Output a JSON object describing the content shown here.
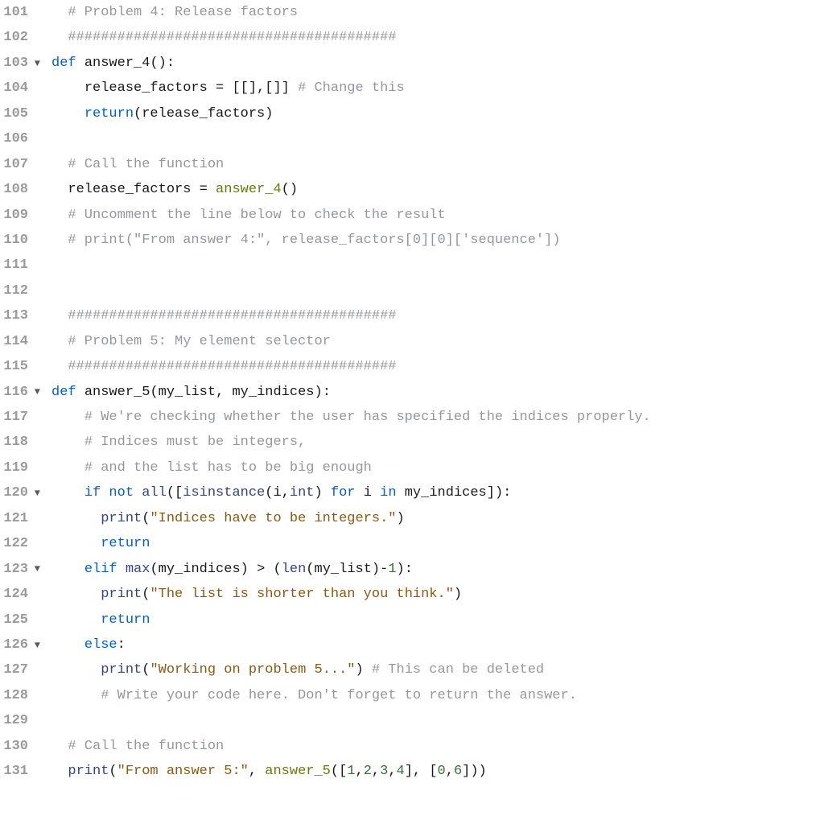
{
  "editor": {
    "lines": [
      {
        "num": "101",
        "fold": "",
        "tokens": [
          [
            "  ",
            "plain"
          ],
          [
            "# Problem 4: Release factors",
            "tok-comment"
          ]
        ]
      },
      {
        "num": "102",
        "fold": "",
        "tokens": [
          [
            "  ",
            "plain"
          ],
          [
            "########################################",
            "tok-comment"
          ]
        ]
      },
      {
        "num": "103",
        "fold": "▼",
        "tokens": [
          [
            "def",
            "tok-keyword"
          ],
          [
            " ",
            "plain"
          ],
          [
            "answer_4",
            "tok-def"
          ],
          [
            "():",
            "tok-paren"
          ]
        ]
      },
      {
        "num": "104",
        "fold": "",
        "tokens": [
          [
            "    ",
            "plain"
          ],
          [
            "release_factors",
            "tok-def"
          ],
          [
            " ",
            "plain"
          ],
          [
            "=",
            "tok-op"
          ],
          [
            " ",
            "plain"
          ],
          [
            "[[],[]]",
            "tok-paren"
          ],
          [
            " ",
            "plain"
          ],
          [
            "# Change this",
            "tok-comment"
          ]
        ]
      },
      {
        "num": "105",
        "fold": "",
        "tokens": [
          [
            "    ",
            "plain"
          ],
          [
            "return",
            "tok-keyword"
          ],
          [
            "(",
            "tok-paren"
          ],
          [
            "release_factors",
            "tok-def"
          ],
          [
            ")",
            "tok-paren"
          ]
        ]
      },
      {
        "num": "106",
        "fold": "",
        "tokens": [
          [
            "",
            "plain"
          ]
        ]
      },
      {
        "num": "107",
        "fold": "",
        "tokens": [
          [
            "  ",
            "plain"
          ],
          [
            "# Call the function",
            "tok-comment"
          ]
        ]
      },
      {
        "num": "108",
        "fold": "",
        "tokens": [
          [
            "  ",
            "plain"
          ],
          [
            "release_factors",
            "tok-def"
          ],
          [
            " ",
            "plain"
          ],
          [
            "=",
            "tok-op"
          ],
          [
            " ",
            "plain"
          ],
          [
            "answer_4",
            "tok-call"
          ],
          [
            "()",
            "tok-paren"
          ]
        ]
      },
      {
        "num": "109",
        "fold": "",
        "tokens": [
          [
            "  ",
            "plain"
          ],
          [
            "# Uncomment the line below to check the result",
            "tok-comment"
          ]
        ]
      },
      {
        "num": "110",
        "fold": "",
        "tokens": [
          [
            "  ",
            "plain"
          ],
          [
            "# print(\"From answer 4:\", release_factors[0][0]['sequence'])",
            "tok-comment"
          ]
        ]
      },
      {
        "num": "111",
        "fold": "",
        "tokens": [
          [
            "",
            "plain"
          ]
        ]
      },
      {
        "num": "112",
        "fold": "",
        "tokens": [
          [
            "",
            "plain"
          ]
        ]
      },
      {
        "num": "113",
        "fold": "",
        "tokens": [
          [
            "  ",
            "plain"
          ],
          [
            "########################################",
            "tok-comment"
          ]
        ]
      },
      {
        "num": "114",
        "fold": "",
        "tokens": [
          [
            "  ",
            "plain"
          ],
          [
            "# Problem 5: My element selector",
            "tok-comment"
          ]
        ]
      },
      {
        "num": "115",
        "fold": "",
        "tokens": [
          [
            "  ",
            "plain"
          ],
          [
            "########################################",
            "tok-comment"
          ]
        ]
      },
      {
        "num": "116",
        "fold": "▼",
        "tokens": [
          [
            "def",
            "tok-keyword"
          ],
          [
            " ",
            "plain"
          ],
          [
            "answer_5",
            "tok-def"
          ],
          [
            "(",
            "tok-paren"
          ],
          [
            "my_list",
            "tok-def"
          ],
          [
            ",",
            "tok-paren"
          ],
          [
            " ",
            "plain"
          ],
          [
            "my_indices",
            "tok-def"
          ],
          [
            "):",
            "tok-paren"
          ]
        ]
      },
      {
        "num": "117",
        "fold": "",
        "tokens": [
          [
            "    ",
            "plain"
          ],
          [
            "# We're checking whether the user has specified the indices properly.",
            "tok-comment"
          ]
        ]
      },
      {
        "num": "118",
        "fold": "",
        "tokens": [
          [
            "    ",
            "plain"
          ],
          [
            "# Indices must be integers,",
            "tok-comment"
          ]
        ]
      },
      {
        "num": "119",
        "fold": "",
        "tokens": [
          [
            "    ",
            "plain"
          ],
          [
            "# and the list has to be big enough",
            "tok-comment"
          ]
        ]
      },
      {
        "num": "120",
        "fold": "▼",
        "tokens": [
          [
            "    ",
            "plain"
          ],
          [
            "if",
            "tok-keyword"
          ],
          [
            " ",
            "plain"
          ],
          [
            "not",
            "tok-keyword"
          ],
          [
            " ",
            "plain"
          ],
          [
            "all",
            "tok-builtin"
          ],
          [
            "([",
            "tok-paren"
          ],
          [
            "isinstance",
            "tok-builtin"
          ],
          [
            "(",
            "tok-paren"
          ],
          [
            "i",
            "tok-def"
          ],
          [
            ",",
            "tok-paren"
          ],
          [
            "int",
            "tok-builtin"
          ],
          [
            ")",
            "tok-paren"
          ],
          [
            " ",
            "plain"
          ],
          [
            "for",
            "tok-keyword"
          ],
          [
            " ",
            "plain"
          ],
          [
            "i",
            "tok-def"
          ],
          [
            " ",
            "plain"
          ],
          [
            "in",
            "tok-keyword"
          ],
          [
            " ",
            "plain"
          ],
          [
            "my_indices",
            "tok-def"
          ],
          [
            "]):",
            "tok-paren"
          ]
        ]
      },
      {
        "num": "121",
        "fold": "",
        "tokens": [
          [
            "      ",
            "plain"
          ],
          [
            "print",
            "tok-builtin"
          ],
          [
            "(",
            "tok-paren"
          ],
          [
            "\"Indices have to be integers.\"",
            "tok-string"
          ],
          [
            ")",
            "tok-paren"
          ]
        ]
      },
      {
        "num": "122",
        "fold": "",
        "tokens": [
          [
            "      ",
            "plain"
          ],
          [
            "return",
            "tok-keyword"
          ]
        ]
      },
      {
        "num": "123",
        "fold": "▼",
        "tokens": [
          [
            "    ",
            "plain"
          ],
          [
            "elif",
            "tok-keyword"
          ],
          [
            " ",
            "plain"
          ],
          [
            "max",
            "tok-builtin"
          ],
          [
            "(",
            "tok-paren"
          ],
          [
            "my_indices",
            "tok-def"
          ],
          [
            ")",
            "tok-paren"
          ],
          [
            " ",
            "plain"
          ],
          [
            ">",
            "tok-op"
          ],
          [
            " ",
            "plain"
          ],
          [
            "(",
            "tok-paren"
          ],
          [
            "len",
            "tok-builtin"
          ],
          [
            "(",
            "tok-paren"
          ],
          [
            "my_list",
            "tok-def"
          ],
          [
            ")",
            "tok-paren"
          ],
          [
            "-",
            "tok-op"
          ],
          [
            "1",
            "tok-number"
          ],
          [
            "):",
            "tok-paren"
          ]
        ]
      },
      {
        "num": "124",
        "fold": "",
        "tokens": [
          [
            "      ",
            "plain"
          ],
          [
            "print",
            "tok-builtin"
          ],
          [
            "(",
            "tok-paren"
          ],
          [
            "\"The list is shorter than you think.\"",
            "tok-string"
          ],
          [
            ")",
            "tok-paren"
          ]
        ]
      },
      {
        "num": "125",
        "fold": "",
        "tokens": [
          [
            "      ",
            "plain"
          ],
          [
            "return",
            "tok-keyword"
          ]
        ]
      },
      {
        "num": "126",
        "fold": "▼",
        "tokens": [
          [
            "    ",
            "plain"
          ],
          [
            "else",
            "tok-keyword"
          ],
          [
            ":",
            "tok-paren"
          ]
        ]
      },
      {
        "num": "127",
        "fold": "",
        "tokens": [
          [
            "      ",
            "plain"
          ],
          [
            "print",
            "tok-builtin"
          ],
          [
            "(",
            "tok-paren"
          ],
          [
            "\"Working on problem 5...\"",
            "tok-string"
          ],
          [
            ")",
            "tok-paren"
          ],
          [
            " ",
            "plain"
          ],
          [
            "# This can be deleted",
            "tok-comment"
          ]
        ]
      },
      {
        "num": "128",
        "fold": "",
        "tokens": [
          [
            "      ",
            "plain"
          ],
          [
            "# Write your code here. Don't forget to return the answer.",
            "tok-comment"
          ]
        ]
      },
      {
        "num": "129",
        "fold": "",
        "tokens": [
          [
            "",
            "plain"
          ]
        ]
      },
      {
        "num": "130",
        "fold": "",
        "tokens": [
          [
            "  ",
            "plain"
          ],
          [
            "# Call the function",
            "tok-comment"
          ]
        ]
      },
      {
        "num": "131",
        "fold": "",
        "tokens": [
          [
            "  ",
            "plain"
          ],
          [
            "print",
            "tok-builtin"
          ],
          [
            "(",
            "tok-paren"
          ],
          [
            "\"From answer 5:\"",
            "tok-string"
          ],
          [
            ",",
            "tok-paren"
          ],
          [
            " ",
            "plain"
          ],
          [
            "answer_5",
            "tok-call"
          ],
          [
            "([",
            "tok-paren"
          ],
          [
            "1",
            "tok-number"
          ],
          [
            ",",
            "tok-paren"
          ],
          [
            "2",
            "tok-number"
          ],
          [
            ",",
            "tok-paren"
          ],
          [
            "3",
            "tok-number"
          ],
          [
            ",",
            "tok-paren"
          ],
          [
            "4",
            "tok-number"
          ],
          [
            "],",
            "tok-paren"
          ],
          [
            " ",
            "plain"
          ],
          [
            "[",
            "tok-paren"
          ],
          [
            "0",
            "tok-number"
          ],
          [
            ",",
            "tok-paren"
          ],
          [
            "6",
            "tok-number"
          ],
          [
            "]))",
            "tok-paren"
          ]
        ]
      }
    ]
  }
}
